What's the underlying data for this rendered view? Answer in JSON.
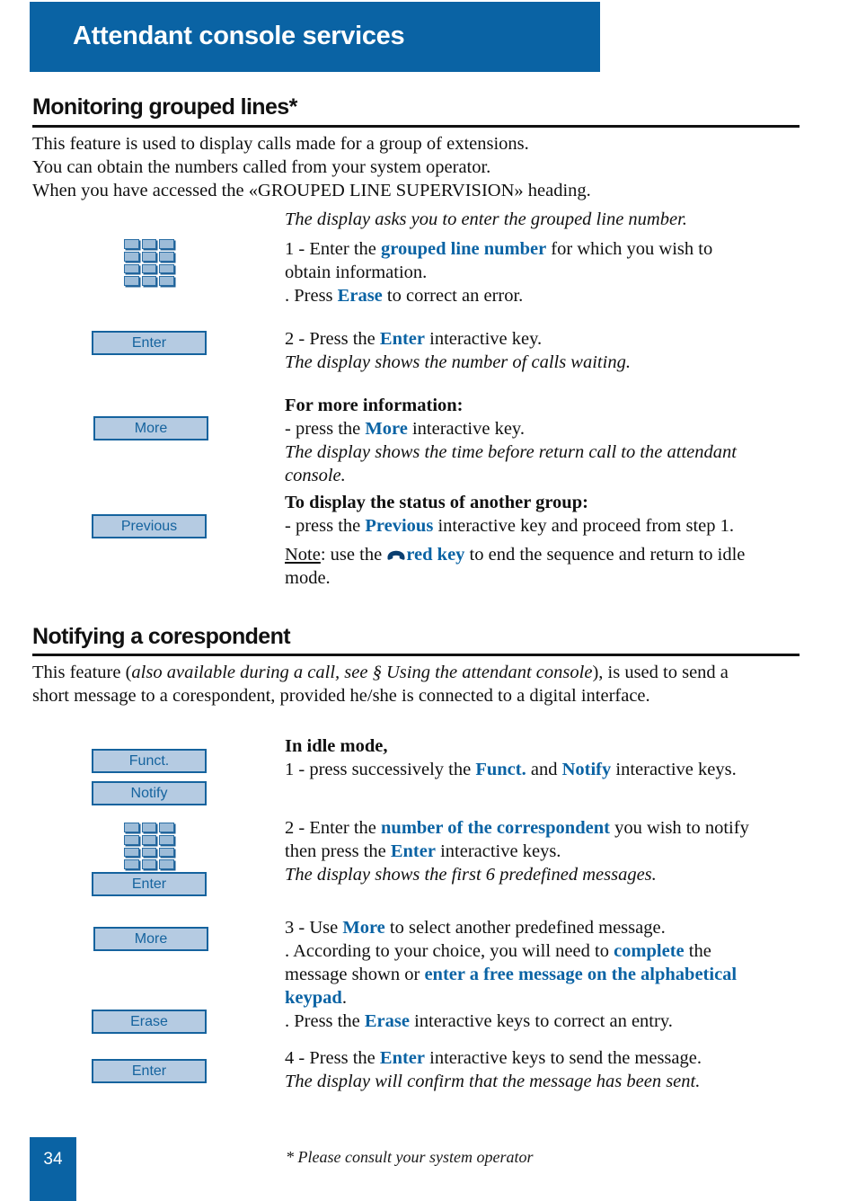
{
  "header": {
    "title": "Attendant console services",
    "banner_color": "#0a63a4"
  },
  "sections": [
    {
      "heading": "Monitoring grouped lines*",
      "intro_lines": [
        "This feature is used to display calls made for a group of extensions.",
        "You can obtain the numbers called from your system operator.",
        "When you have accessed the «GROUPED LINE SUPERVISION» heading."
      ]
    },
    {
      "heading": "Notifying a corespondent",
      "intro_parts": {
        "a": "This feature (",
        "b": "also available during a call, see § Using the attendant console",
        "c": "), is used to send a",
        "d": "short message to a corespondent, provided he/she is connected to a digital interface."
      }
    }
  ],
  "section1": {
    "display_note": "The display asks you to enter the grouped line number.",
    "step1": {
      "a": "1 - Enter the ",
      "b": "grouped line number",
      "c": " for which you wish to",
      "d": "obtain information.",
      "e": ". Press ",
      "f": "Erase",
      "g": " to correct an error."
    },
    "step2": {
      "a": "2 - Press the ",
      "b": "Enter",
      "c": " interactive key.",
      "d": "The display shows the number of calls waiting."
    },
    "more_info": {
      "title": "For more information:",
      "a": "- press the ",
      "b": "More",
      "c": " interactive key.",
      "d": "The display shows the time before return call to the attendant",
      "e": "console."
    },
    "another_group": {
      "title": "To display the status of another group:",
      "a": "- press the ",
      "b": "Previous",
      "c": " interactive key and proceed from step 1."
    },
    "note": {
      "label": "Note",
      "a": ": use the ",
      "b": "red key",
      "c": " to end the sequence and return to idle",
      "d": "mode."
    },
    "buttons": [
      {
        "label": "Enter",
        "name": "enter"
      },
      {
        "label": "More",
        "name": "more"
      },
      {
        "label": "Previous",
        "name": "previous"
      }
    ],
    "keypad_icon": "numeric-keypad-icon",
    "red_key_icon": "handset-hangup-icon"
  },
  "section2": {
    "step1": {
      "title": "In idle mode,",
      "a": "1 - press successively the ",
      "b": "Funct.",
      "c": " and ",
      "d": "Notify",
      "e": " interactive keys."
    },
    "step2": {
      "a": "2 - Enter the ",
      "b": "number of the correspondent",
      "c": " you wish to notify",
      "d": "then press the ",
      "e": "Enter",
      "f": " interactive keys.",
      "g": "The display shows the first 6 predefined messages."
    },
    "step3": {
      "a": "3 - Use ",
      "b": "More",
      "c": " to select another predefined message.",
      "d": ". According to your choice, you will need to ",
      "e": "complete",
      "f": " the",
      "g": "message shown or ",
      "h": "enter a free message on the alphabetical",
      "i": "keypad",
      "j": ".",
      "k": ". Press the ",
      "l": "Erase",
      "m": " interactive keys to correct an entry."
    },
    "step4": {
      "a": "4 - Press the ",
      "b": "Enter",
      "c": " interactive keys to send the message.",
      "d": "The display will confirm that the message has been sent."
    },
    "buttons": [
      {
        "label": "Funct.",
        "name": "funct"
      },
      {
        "label": "Notify",
        "name": "notify"
      },
      {
        "label": "Enter",
        "name": "enter-1"
      },
      {
        "label": "More",
        "name": "more"
      },
      {
        "label": "Erase",
        "name": "erase"
      },
      {
        "label": "Enter",
        "name": "enter-2"
      }
    ],
    "keypad_icon": "numeric-keypad-icon"
  },
  "footer": {
    "page_number": "34",
    "footnote": "* Please consult your system operator"
  }
}
